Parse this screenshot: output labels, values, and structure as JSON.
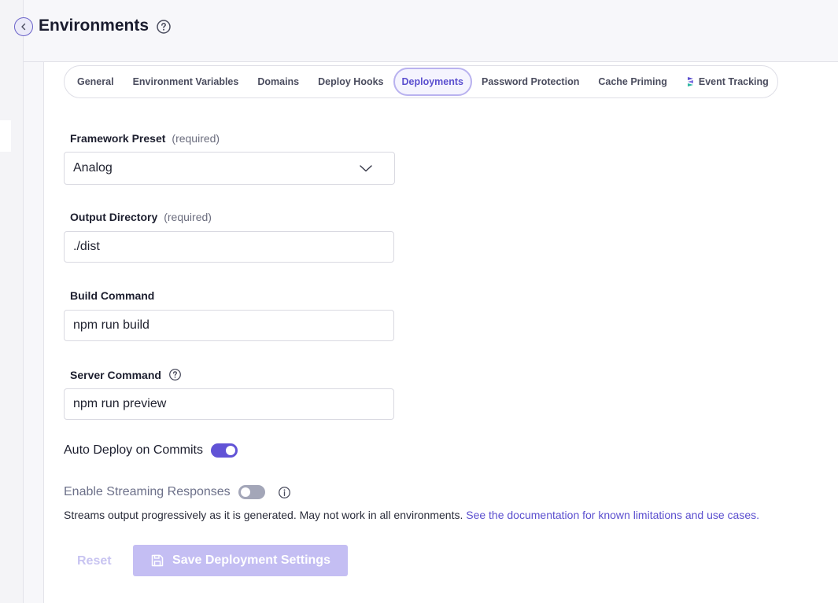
{
  "header": {
    "title": "Environments",
    "back_icon": "chevron-left-icon",
    "help_icon": "question-circle-icon"
  },
  "tabs": [
    {
      "label": "General",
      "active": false
    },
    {
      "label": "Environment Variables",
      "active": false
    },
    {
      "label": "Domains",
      "active": false
    },
    {
      "label": "Deploy Hooks",
      "active": false
    },
    {
      "label": "Deployments",
      "active": true
    },
    {
      "label": "Password Protection",
      "active": false
    },
    {
      "label": "Cache Priming",
      "active": false
    },
    {
      "label": "Event Tracking",
      "active": false,
      "icon": "stack-icon"
    }
  ],
  "form": {
    "framework": {
      "label": "Framework Preset",
      "required": "(required)",
      "value": "Analog"
    },
    "output_dir": {
      "label": "Output Directory",
      "required": "(required)",
      "value": "./dist"
    },
    "build_cmd": {
      "label": "Build Command",
      "value": "npm run build"
    },
    "server_cmd": {
      "label": "Server Command",
      "value": "npm run preview"
    },
    "auto_deploy": {
      "label": "Auto Deploy on Commits",
      "enabled": true
    },
    "streaming": {
      "label": "Enable Streaming Responses",
      "enabled": false,
      "description": "Streams output progressively as it is generated. May not work in all environments.",
      "link": "See the documentation for known limitations and use cases."
    }
  },
  "actions": {
    "reset_label": "Reset",
    "save_label": "Save Deployment Settings"
  },
  "colors": {
    "accent": "#5b4fcf",
    "toggle_on": "#6153d6",
    "save_disabled": "#c4bef3"
  }
}
